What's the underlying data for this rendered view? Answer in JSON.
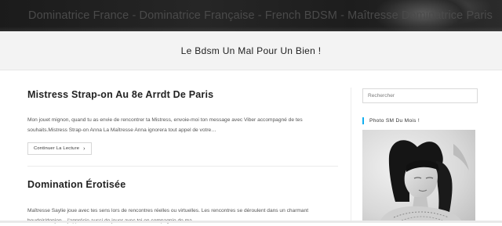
{
  "header": {
    "site_title": "Dominatrice France - Dominatrice Française - French BDSM - Maîtresse Dominatrice Paris",
    "tagline": "Le Bdsm Un Mal Pour Un Bien !"
  },
  "posts": [
    {
      "title": "Mistress Strap-on Au 8e Arrdt De Paris",
      "excerpt": "Mon jouet mignon, quand tu as envie de rencontrer ta Mistress, envoie-moi ton message avec Viber accompagné de tes souhaits.Mistress Strap-on Anna La Maîtresse Anna ignorera tout appel de votre…",
      "read_more": "Continuer La Lecture",
      "read_more_icon": "chevron-right-icon"
    },
    {
      "title": "Domination Érotisée",
      "excerpt": "Maîtresse Saylie joue avec tes sens lors de rencontres réelles ou virtuelles. Les rencontres se déroulent dans un charmant boudoir/donjon... j'apprécie aussi de jouer avec toi en compagnie de ma"
    }
  ],
  "sidebar": {
    "search_placeholder": "Rechercher",
    "widget_title": "Photo SM Du Mois !",
    "widget_accent": "#13aff0",
    "photo_desc": "black-and-white portrait photo"
  },
  "colors": {
    "banner_bg": "#222222",
    "tagline_bg": "#f3f3f3",
    "accent": "#13aff0"
  }
}
